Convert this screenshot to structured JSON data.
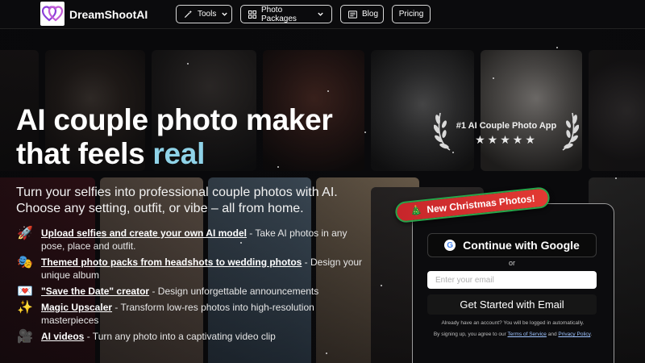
{
  "brand": {
    "name": "DreamShootAI",
    "logo_icon": "double-heart-icon",
    "logo_color": "#8b3fd9"
  },
  "nav": {
    "tools_label": "Tools",
    "packages_label": "Photo Packages",
    "blog_label": "Blog",
    "pricing_label": "Pricing"
  },
  "hero": {
    "title_line1": "AI couple photo maker",
    "title_line2_prefix": "that feels",
    "title_highlight": "real",
    "highlight_color": "#8fd3e8",
    "subtitle": "Turn your selfies into professional couple photos with AI. Choose any setting, outfit, or vibe – all from home."
  },
  "features": [
    {
      "emoji": "🚀",
      "link": "Upload selfies and create your own AI model",
      "text": " - Take AI photos in any pose, place and outfit."
    },
    {
      "emoji": "🎭",
      "link": "Themed photo packs from headshots to wedding photos",
      "text": " - Design your unique album"
    },
    {
      "emoji": "💌",
      "link": "\"Save the Date\" creator",
      "text": " - Design unforgettable announcements"
    },
    {
      "emoji": "✨",
      "link": "Magic Upscaler",
      "text": " - Transform low-res photos into high-resolution masterpieces"
    },
    {
      "emoji": "🎥",
      "link": "AI videos",
      "text": " - Turn any photo into a captivating video clip"
    }
  ],
  "badge": {
    "title": "#1 AI Couple Photo App",
    "stars": "★★★★★",
    "rating_stars": 5
  },
  "signup": {
    "ribbon_emoji": "🎄",
    "ribbon": "New Christmas Photos!",
    "google_label": "Continue with Google",
    "or": "or",
    "email_placeholder": "Enter your email",
    "start_label": "Get Started with Email",
    "account_note": "Already have an account? You will be logged in automatically.",
    "terms_prefix": "By signing up, you agree to our ",
    "terms_link": "Terms of Service",
    "and": " and ",
    "privacy_link": "Privacy Policy",
    "terms_suffix": "."
  }
}
